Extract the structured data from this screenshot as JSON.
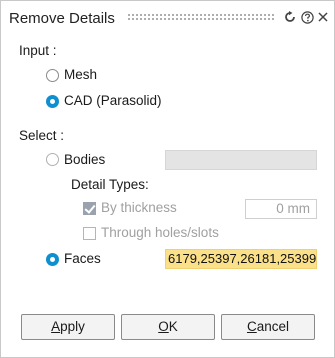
{
  "window": {
    "title": "Remove Details",
    "icons": [
      "reset-icon",
      "help-icon",
      "close-icon"
    ]
  },
  "input": {
    "heading": "Input :",
    "options": [
      {
        "label": "Mesh",
        "selected": false
      },
      {
        "label": "CAD (Parasolid)",
        "selected": true
      }
    ]
  },
  "select": {
    "heading": "Select :",
    "bodies": {
      "label": "Bodies",
      "selected": false,
      "value": ""
    },
    "detail_types": {
      "heading": "Detail Types:",
      "by_thickness": {
        "label": "By thickness",
        "checked": true,
        "enabled": false,
        "value": "0 mm"
      },
      "through_holes": {
        "label": "Through holes/slots",
        "checked": false,
        "enabled": false
      }
    },
    "faces": {
      "label": "Faces",
      "selected": true,
      "value": "6179,25397,26181,25399"
    }
  },
  "buttons": {
    "apply": {
      "mnemonic": "A",
      "rest": "pply"
    },
    "ok": {
      "mnemonic": "O",
      "rest": "K"
    },
    "cancel": {
      "mnemonic": "C",
      "rest": "ancel"
    }
  },
  "colors": {
    "accent": "#0d8fd0",
    "faces_highlight": "#fbe08a"
  }
}
